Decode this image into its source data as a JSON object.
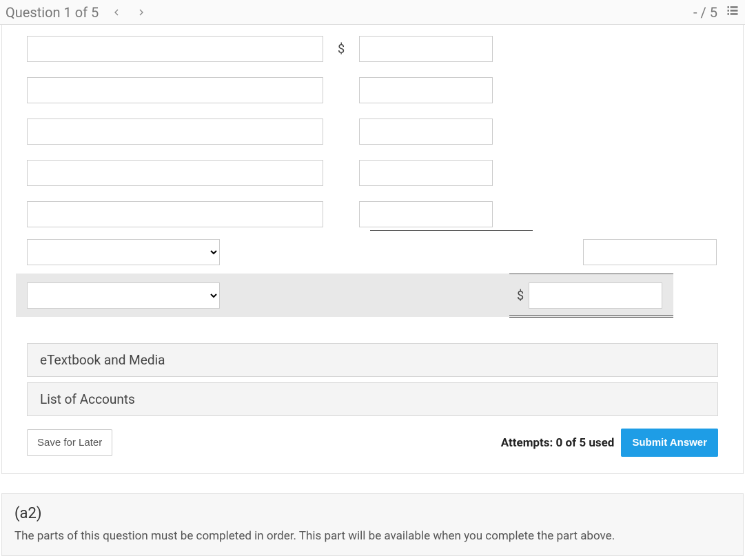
{
  "topbar": {
    "question_label": "Question 1 of 5",
    "score": "- / 5"
  },
  "symbols": {
    "dollar": "$"
  },
  "accordions": {
    "etextbook": "eTextbook and Media",
    "accounts": "List of Accounts"
  },
  "actions": {
    "save": "Save for Later",
    "attempts": "Attempts: 0 of 5 used",
    "submit": "Submit Answer"
  },
  "next_part": {
    "label": "(a2)",
    "message": "The parts of this question must be completed in order. This part will be available when you complete the part above."
  }
}
